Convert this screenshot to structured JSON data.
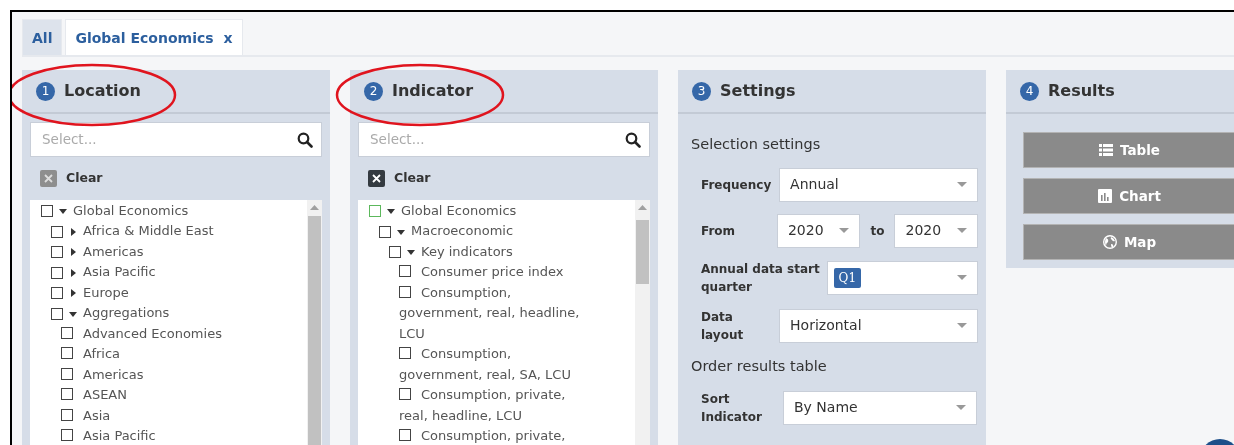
{
  "tabs": [
    {
      "label": "All",
      "selected": false
    },
    {
      "label": "Global Economics",
      "close": "x",
      "selected": true
    }
  ],
  "panels": [
    {
      "kind": "tree",
      "number": "1",
      "title": "Location",
      "annotated": true,
      "search": {
        "placeholder": "Select..."
      },
      "clear": {
        "label": "Clear",
        "disabled": true
      },
      "tree": [
        {
          "label": "Global Economics",
          "kind": "branch",
          "expanded": true,
          "checked": false,
          "focused": false,
          "children": [
            {
              "label": "Africa & Middle East",
              "kind": "branch",
              "expanded": false,
              "checked": false,
              "focused": false
            },
            {
              "label": "Americas",
              "kind": "branch",
              "expanded": false,
              "checked": false,
              "focused": false
            },
            {
              "label": "Asia Pacific",
              "kind": "branch",
              "expanded": false,
              "checked": false,
              "focused": false
            },
            {
              "label": "Europe",
              "kind": "branch",
              "expanded": false,
              "checked": false,
              "focused": false
            },
            {
              "label": "Aggregations",
              "kind": "branch",
              "expanded": true,
              "checked": false,
              "focused": false,
              "children": [
                {
                  "label": "Advanced Economies",
                  "kind": "leaf",
                  "checked": false,
                  "focused": false
                },
                {
                  "label": "Africa",
                  "kind": "leaf",
                  "checked": false,
                  "focused": false
                },
                {
                  "label": "Americas",
                  "kind": "leaf",
                  "checked": false,
                  "focused": false
                },
                {
                  "label": "ASEAN",
                  "kind": "leaf",
                  "checked": false,
                  "focused": false
                },
                {
                  "label": "Asia",
                  "kind": "leaf",
                  "checked": false,
                  "focused": false
                },
                {
                  "label": "Asia Pacific",
                  "kind": "leaf",
                  "checked": false,
                  "focused": false
                }
              ]
            }
          ]
        }
      ]
    },
    {
      "kind": "tree",
      "number": "2",
      "title": "Indicator",
      "annotated": true,
      "search": {
        "placeholder": "Select..."
      },
      "clear": {
        "label": "Clear",
        "disabled": false
      },
      "tree": [
        {
          "label": "Global Economics",
          "kind": "branch",
          "expanded": true,
          "checked": false,
          "focused": true,
          "children": [
            {
              "label": "Macroeconomic",
              "kind": "branch",
              "expanded": true,
              "checked": false,
              "focused": false,
              "children": [
                {
                  "label": "Key indicators",
                  "kind": "branch",
                  "expanded": true,
                  "checked": false,
                  "focused": false,
                  "children": [
                    {
                      "label": "Consumer price index",
                      "kind": "leaf",
                      "checked": false,
                      "focused": false
                    },
                    {
                      "label": "Consumption, government, real, headline, LCU",
                      "kind": "leaf",
                      "checked": false,
                      "focused": false
                    },
                    {
                      "label": "Consumption, government, real, SA, LCU",
                      "kind": "leaf",
                      "checked": false,
                      "focused": false
                    },
                    {
                      "label": "Consumption, private, real, headline, LCU",
                      "kind": "leaf",
                      "checked": false,
                      "focused": false
                    },
                    {
                      "label": "Consumption, private,",
                      "kind": "leaf",
                      "checked": false,
                      "focused": false
                    }
                  ]
                }
              ]
            }
          ]
        }
      ]
    },
    {
      "kind": "settings",
      "number": "3",
      "title": "Settings",
      "annotated": false,
      "sections": [
        {
          "heading": "Selection settings",
          "rows": [
            {
              "kind": "select",
              "label": "Frequency",
              "value": "Annual"
            },
            {
              "kind": "range",
              "label": "From",
              "from": "2020",
              "joiner": "to",
              "to": "2020"
            },
            {
              "kind": "tags",
              "label": "Annual data start quarter",
              "tags": [
                "Q1"
              ]
            },
            {
              "kind": "select",
              "label": "Data layout",
              "value": "Horizontal"
            }
          ]
        },
        {
          "heading": "Order results table",
          "rows": [
            {
              "kind": "select",
              "label": "Sort Indicator",
              "value": "By Name"
            }
          ]
        }
      ]
    },
    {
      "kind": "results",
      "number": "4",
      "title": "Results",
      "annotated": false,
      "buttons": [
        {
          "kind": "table",
          "label": "Table"
        },
        {
          "kind": "chart",
          "label": "Chart"
        },
        {
          "kind": "map",
          "label": "Map"
        }
      ]
    }
  ]
}
